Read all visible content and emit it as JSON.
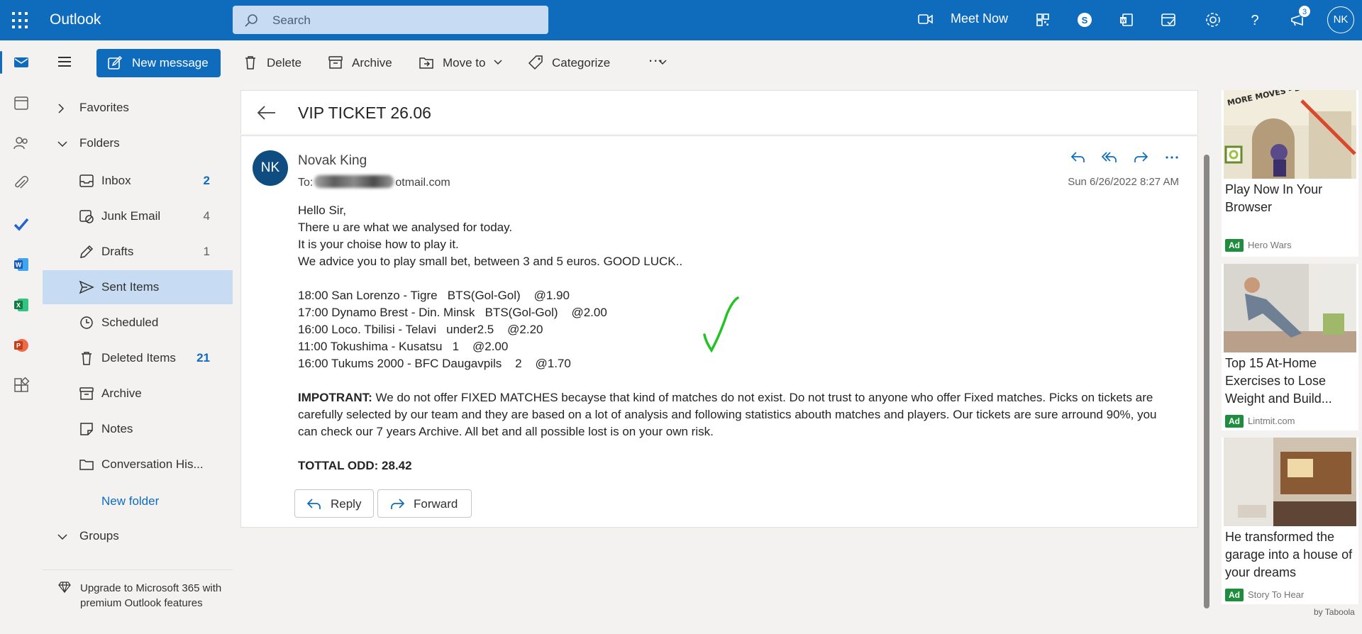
{
  "app": {
    "name": "Outlook"
  },
  "search": {
    "placeholder": "Search"
  },
  "topbar": {
    "meet_now": "Meet Now",
    "notif_count": "3",
    "user_initials": "NK"
  },
  "toolbar": {
    "new_message": "New message",
    "delete": "Delete",
    "archive": "Archive",
    "move_to": "Move to",
    "categorize": "Categorize",
    "more": "..."
  },
  "folders": {
    "favorites": "Favorites",
    "folders_header": "Folders",
    "items": [
      {
        "label": "Inbox",
        "count": "2",
        "icon": "inbox-icon"
      },
      {
        "label": "Junk Email",
        "count": "4",
        "icon": "junk-icon"
      },
      {
        "label": "Drafts",
        "count": "1",
        "icon": "drafts-icon"
      },
      {
        "label": "Sent Items",
        "count": "",
        "icon": "send-icon"
      },
      {
        "label": "Scheduled",
        "count": "",
        "icon": "clock-icon"
      },
      {
        "label": "Deleted Items",
        "count": "21",
        "icon": "trash-icon"
      },
      {
        "label": "Archive",
        "count": "",
        "icon": "archive-icon"
      },
      {
        "label": "Notes",
        "count": "",
        "icon": "note-icon"
      },
      {
        "label": "Conversation His...",
        "count": "",
        "icon": "folder-icon"
      }
    ],
    "new_folder": "New folder",
    "groups": "Groups",
    "upgrade": "Upgrade to Microsoft 365 with premium Outlook features"
  },
  "message": {
    "subject": "VIP TICKET 26.06",
    "sender_initials": "NK",
    "sender": "Novak King",
    "to_prefix": "To:",
    "to_suffix": "otmail.com",
    "date": "Sun 6/26/2022 8:27 AM",
    "greeting": "Hello Sir,",
    "line1": "There u are what we analysed for today.",
    "line2": "It is your choise how to play it.",
    "line3": "We advice you to play small bet, between 3 and 5 euros. GOOD LUCK..",
    "picks": [
      "18:00 San Lorenzo - Tigre   BTS(Gol-Gol)    @1.90",
      "17:00 Dynamo Brest - Din. Minsk   BTS(Gol-Gol)    @2.00",
      "16:00 Loco. Tbilisi - Telavi   under2.5    @2.20",
      "11:00 Tokushima - Kusatsu   1    @2.00",
      "16:00 Tukums 2000 - BFC Daugavpils    2    @1.70"
    ],
    "important_label": "IMPOTRANT:",
    "important_text": " We do not offer FIXED MATCHES becayse that kind of matches do not exist. Do not trust to anyone who offer Fixed matches. Picks on tickets are carefully selected by our team and they are based on a lot of analysis and following statistics abouth matches and players. Our tickets are sure arround 90%, you can check our 7 years Archive. All bet and all possible lost is on your own risk.",
    "total": "TOTTAL ODD: 28.42",
    "reply": "Reply",
    "forward": "Forward"
  },
  "ads": [
    {
      "title": "Play Now In Your Browser",
      "tag": "Ad",
      "source": "Hero Wars",
      "img_text": "MORE MOVES - LOWER IQ"
    },
    {
      "title": "Top 15 At-Home Exercises to Lose Weight and Build...",
      "tag": "Ad",
      "source": "Lintmit.com"
    },
    {
      "title": "He transformed the garage into a house of your dreams",
      "tag": "Ad",
      "source": "Story To Hear"
    }
  ],
  "taboola": "by Taboola",
  "colors": {
    "brand": "#0f6cbd",
    "selected": "#c7dcf2",
    "ad_tag": "#1e8e3e",
    "check": "#22c322"
  }
}
